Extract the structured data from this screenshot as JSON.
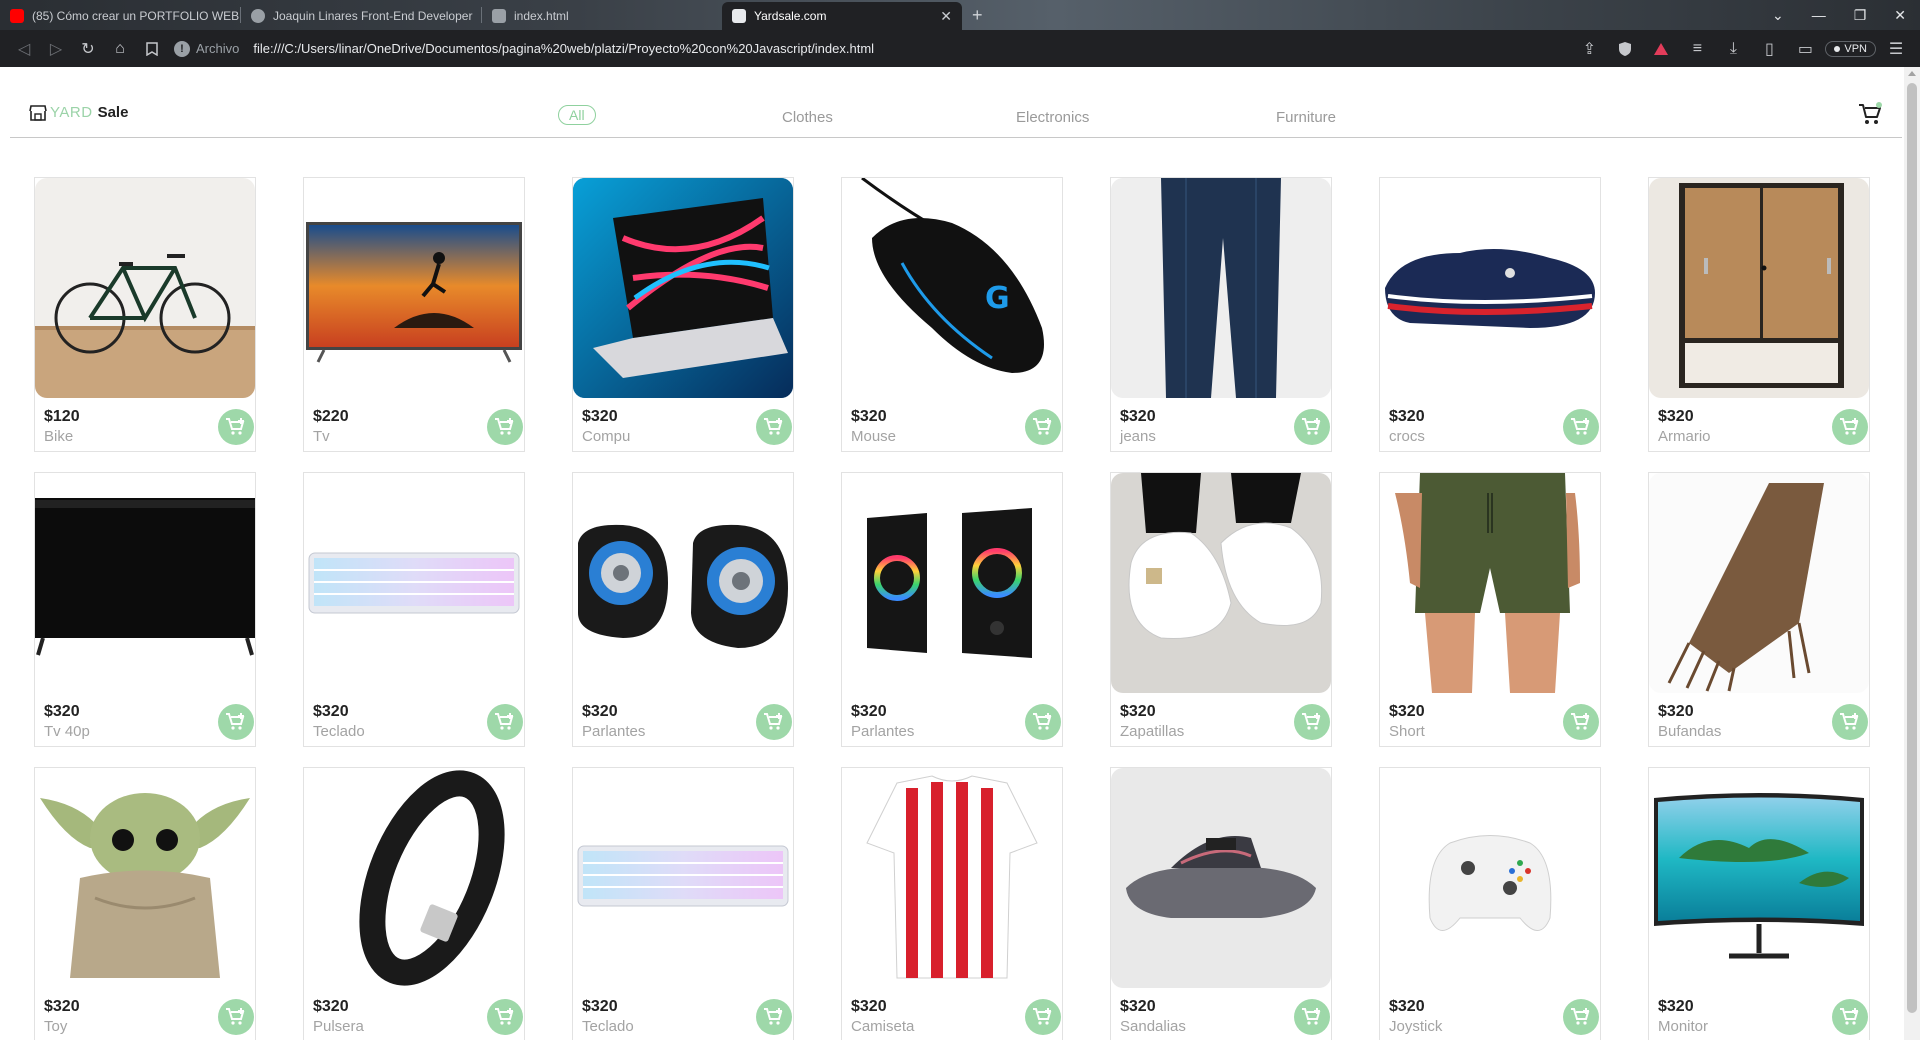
{
  "browser": {
    "tabs": [
      {
        "title": "(85) Cómo crear un PORTFOLIO WEB",
        "favicon": "youtube-icon",
        "favicon_color": "#ff0000"
      },
      {
        "title": "Joaquin Linares Front-End Developer",
        "favicon": "globe-icon",
        "favicon_color": "#9aa0a6"
      },
      {
        "title": "index.html",
        "favicon": "file-icon",
        "favicon_color": "#9aa0a6"
      },
      {
        "title": "Yardsale.com",
        "favicon": "page-icon",
        "favicon_color": "#e8eaed"
      }
    ],
    "address_scheme": "Archivo",
    "url": "file:///C:/Users/linar/OneDrive/Documentos/pagina%20web/platzi/Proyecto%20con%20Javascript/index.html",
    "vpn_label": "VPN"
  },
  "page": {
    "logo": {
      "yard": "YARD",
      "sale": "Sale"
    },
    "categories": [
      "All",
      "Clothes",
      "Electronics",
      "Furniture"
    ],
    "active_category": "All",
    "accent_color": "#9ed8a9",
    "products": [
      {
        "price": "$120",
        "name": "Bike"
      },
      {
        "price": "$220",
        "name": "Tv"
      },
      {
        "price": "$320",
        "name": "Compu"
      },
      {
        "price": "$320",
        "name": "Mouse"
      },
      {
        "price": "$320",
        "name": "jeans"
      },
      {
        "price": "$320",
        "name": "crocs"
      },
      {
        "price": "$320",
        "name": "Armario"
      },
      {
        "price": "$320",
        "name": "Tv 40p"
      },
      {
        "price": "$320",
        "name": "Teclado"
      },
      {
        "price": "$320",
        "name": "Parlantes"
      },
      {
        "price": "$320",
        "name": "Parlantes"
      },
      {
        "price": "$320",
        "name": "Zapatillas"
      },
      {
        "price": "$320",
        "name": "Short"
      },
      {
        "price": "$320",
        "name": "Bufandas"
      },
      {
        "price": "$320",
        "name": "Toy"
      },
      {
        "price": "$320",
        "name": "Pulsera"
      },
      {
        "price": "$320",
        "name": "Teclado"
      },
      {
        "price": "$320",
        "name": "Camiseta"
      },
      {
        "price": "$320",
        "name": "Sandalias"
      },
      {
        "price": "$320",
        "name": "Joystick"
      },
      {
        "price": "$320",
        "name": "Monitor"
      }
    ]
  }
}
